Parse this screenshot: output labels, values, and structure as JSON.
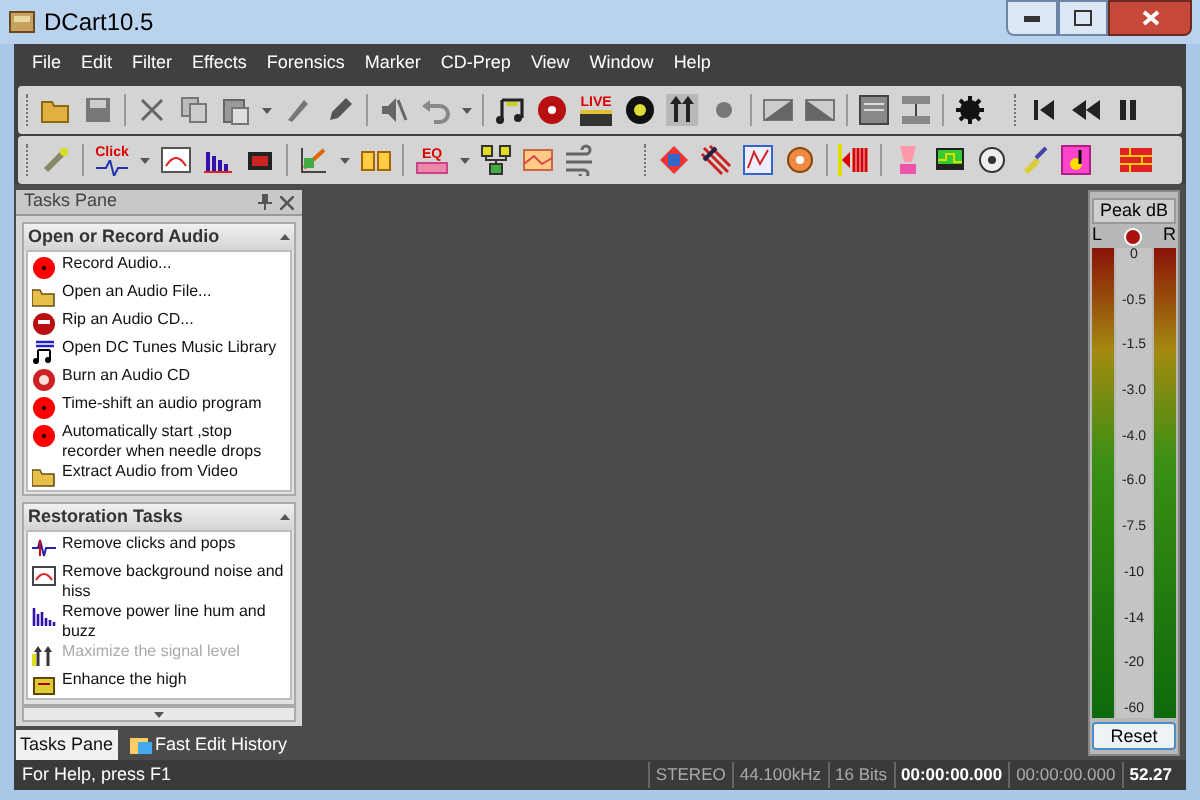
{
  "window": {
    "title": "DCart10.5"
  },
  "menu": [
    "File",
    "Edit",
    "Filter",
    "Effects",
    "Forensics",
    "Marker",
    "CD-Prep",
    "View",
    "Window",
    "Help"
  ],
  "toolbar_labels": {
    "click": "Click",
    "live": "LIVE",
    "eq": "EQ"
  },
  "tasks_pane": {
    "title": "Tasks Pane",
    "sections": [
      {
        "title": "Open or Record Audio",
        "items": [
          {
            "kind": "record",
            "label": "Record Audio...",
            "disabled": false
          },
          {
            "kind": "folder",
            "label": "Open an Audio File...",
            "disabled": false
          },
          {
            "kind": "rip",
            "label": "Rip an Audio CD...",
            "disabled": false
          },
          {
            "kind": "music",
            "label": "Open DC Tunes Music Library",
            "disabled": false
          },
          {
            "kind": "burn",
            "label": "Burn an Audio CD",
            "disabled": false
          },
          {
            "kind": "record",
            "label": "Time-shift an audio program",
            "disabled": false
          },
          {
            "kind": "record",
            "label": "Automatically start ,stop recorder when needle drops",
            "disabled": false
          },
          {
            "kind": "folder",
            "label": "Extract Audio from Video",
            "disabled": false
          }
        ]
      },
      {
        "title": "Restoration Tasks",
        "items": [
          {
            "kind": "click",
            "label": "Remove clicks and pops",
            "disabled": false
          },
          {
            "kind": "noise",
            "label": "Remove background noise and hiss",
            "disabled": false
          },
          {
            "kind": "hum",
            "label": "Remove power line hum and buzz",
            "disabled": false
          },
          {
            "kind": "max",
            "label": "Maximize the signal level",
            "disabled": true
          },
          {
            "kind": "enhance",
            "label": "Enhance the high",
            "disabled": false
          }
        ]
      }
    ]
  },
  "bottom_tabs": [
    {
      "label": "Tasks Pane",
      "selected": true
    },
    {
      "label": "Fast Edit History",
      "selected": false
    }
  ],
  "meter": {
    "title": "Peak dB",
    "left": "L",
    "right": "R",
    "scale": [
      "0",
      "-0.5",
      "-1.5",
      "-3.0",
      "-4.0",
      "-6.0",
      "-7.5",
      "-10",
      "-14",
      "-20",
      "-60"
    ],
    "reset": "Reset"
  },
  "status_bar": {
    "help": "For Help, press F1",
    "fields": [
      {
        "text": "STEREO",
        "bold": false
      },
      {
        "text": "44.100kHz",
        "bold": false
      },
      {
        "text": "16 Bits",
        "bold": false
      },
      {
        "text": "00:00:00.000",
        "bold": true
      },
      {
        "text": "00:00:00.000",
        "bold": false
      },
      {
        "text": "52.27",
        "bold": true
      }
    ]
  }
}
